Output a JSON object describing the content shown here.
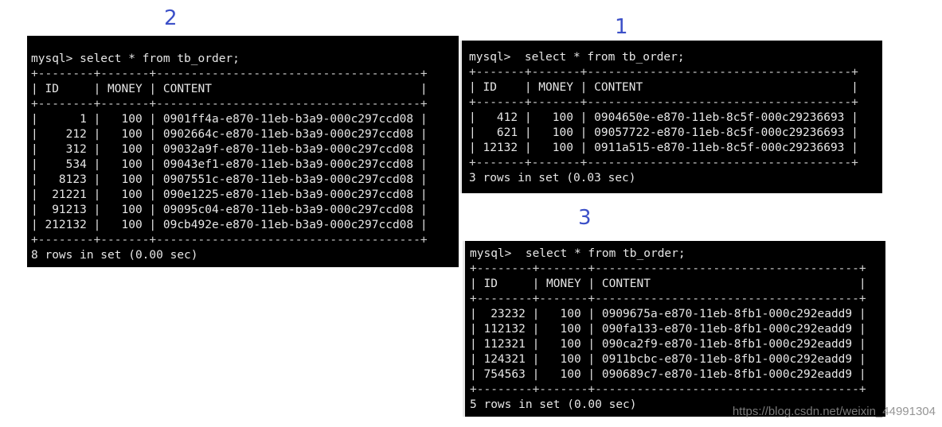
{
  "labels": {
    "two": "2",
    "one": "1",
    "three": "3"
  },
  "terminal_2": {
    "prompt": "mysql> select * from tb_order;",
    "border": "+--------+-------+--------------------------------------+",
    "header": "| ID     | MONEY | CONTENT                              |",
    "rows": [
      "|      1 |   100 | 0901ff4a-e870-11eb-b3a9-000c297ccd08 |",
      "|    212 |   100 | 0902664c-e870-11eb-b3a9-000c297ccd08 |",
      "|    312 |   100 | 09032a9f-e870-11eb-b3a9-000c297ccd08 |",
      "|    534 |   100 | 09043ef1-e870-11eb-b3a9-000c297ccd08 |",
      "|   8123 |   100 | 0907551c-e870-11eb-b3a9-000c297ccd08 |",
      "|  21221 |   100 | 090e1225-e870-11eb-b3a9-000c297ccd08 |",
      "|  91213 |   100 | 09095c04-e870-11eb-b3a9-000c297ccd08 |",
      "| 212132 |   100 | 09cb492e-e870-11eb-b3a9-000c297ccd08 |"
    ],
    "footer": "8 rows in set (0.00 sec)"
  },
  "terminal_1": {
    "prompt": "mysql>  select * from tb_order;",
    "border": "+-------+-------+--------------------------------------+",
    "header": "| ID    | MONEY | CONTENT                              |",
    "rows": [
      "|   412 |   100 | 0904650e-e870-11eb-8c5f-000c29236693 |",
      "|   621 |   100 | 09057722-e870-11eb-8c5f-000c29236693 |",
      "| 12132 |   100 | 0911a515-e870-11eb-8c5f-000c29236693 |"
    ],
    "footer": "3 rows in set (0.03 sec)"
  },
  "terminal_3": {
    "prompt": "mysql>  select * from tb_order;",
    "border": "+--------+-------+--------------------------------------+",
    "header": "| ID     | MONEY | CONTENT                              |",
    "rows": [
      "|  23232 |   100 | 0909675a-e870-11eb-8fb1-000c292eadd9 |",
      "| 112132 |   100 | 090fa133-e870-11eb-8fb1-000c292eadd9 |",
      "| 112321 |   100 | 090ca2f9-e870-11eb-8fb1-000c292eadd9 |",
      "| 124321 |   100 | 0911bcbc-e870-11eb-8fb1-000c292eadd9 |",
      "| 754563 |   100 | 090689c7-e870-11eb-8fb1-000c292eadd9 |"
    ],
    "footer": "5 rows in set (0.00 sec)"
  },
  "watermark": "https://blog.csdn.net/weixin_44991304",
  "colors": {
    "label": "#3c50c8",
    "terminal_bg": "#000000",
    "terminal_text": "#e6e6e6"
  }
}
